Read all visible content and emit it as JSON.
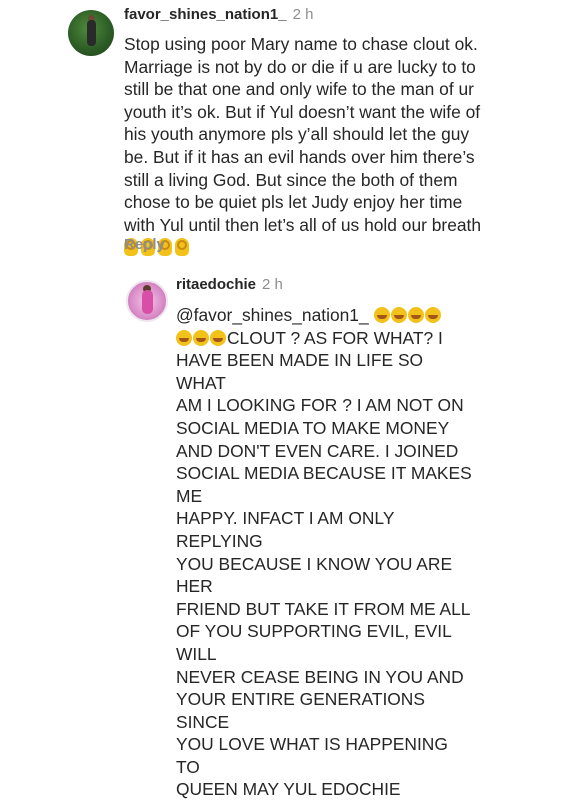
{
  "comment_1": {
    "username": "favor_shines_nation1_",
    "time": "2 h",
    "lines": [
      "Stop using poor Mary name to chase clout ok.",
      "Marriage is not by do or die if u are lucky to to",
      "still be that one and only wife to the man of ur",
      "youth it’s ok. But if Yul doesn’t want the wife of",
      "his youth anymore pls y’all should let the guy",
      "be. But if it has an evil hands over him there’s",
      "still a living God. But since the both of them",
      "chose to be quiet pls let Judy enjoy her time",
      "with Yul until then let’s all of us hold our breath"
    ],
    "emoji_line": "👌👌👌👌",
    "reply_label": "Reply"
  },
  "comment_2": {
    "username": "ritaedochie",
    "time": "2 h",
    "mention": "@favor_shines_nation1_",
    "line2_text": "CLOUT ? AS FOR WHAT? I",
    "lines": [
      "HAVE BEEN  MADE IN LIFE SO WHAT",
      "AM I LOOKING  FOR ? I AM NOT ON",
      "SOCIAL MEDIA TO MAKE MONEY",
      "AND DON'T EVEN CARE.  I JOINED",
      "SOCIAL MEDIA BECAUSE IT MAKES ME",
      "HAPPY.  INFACT I AM ONLY REPLYING",
      "YOU BECAUSE I KNOW YOU ARE HER",
      "FRIEND BUT TAKE IT FROM ME ALL",
      "OF YOU SUPPORTING EVIL, EVIL WILL",
      "NEVER  CEASE BEING IN YOU AND",
      "YOUR ENTIRE GENERATIONS  SINCE",
      "YOU LOVE WHAT IS HAPPENING TO",
      "QUEEN MAY YUL EDOCHIE"
    ]
  },
  "colors": {
    "text": "#262626",
    "muted": "#8e8e8e",
    "background": "#ffffff",
    "emoji": "#f2c21b"
  }
}
